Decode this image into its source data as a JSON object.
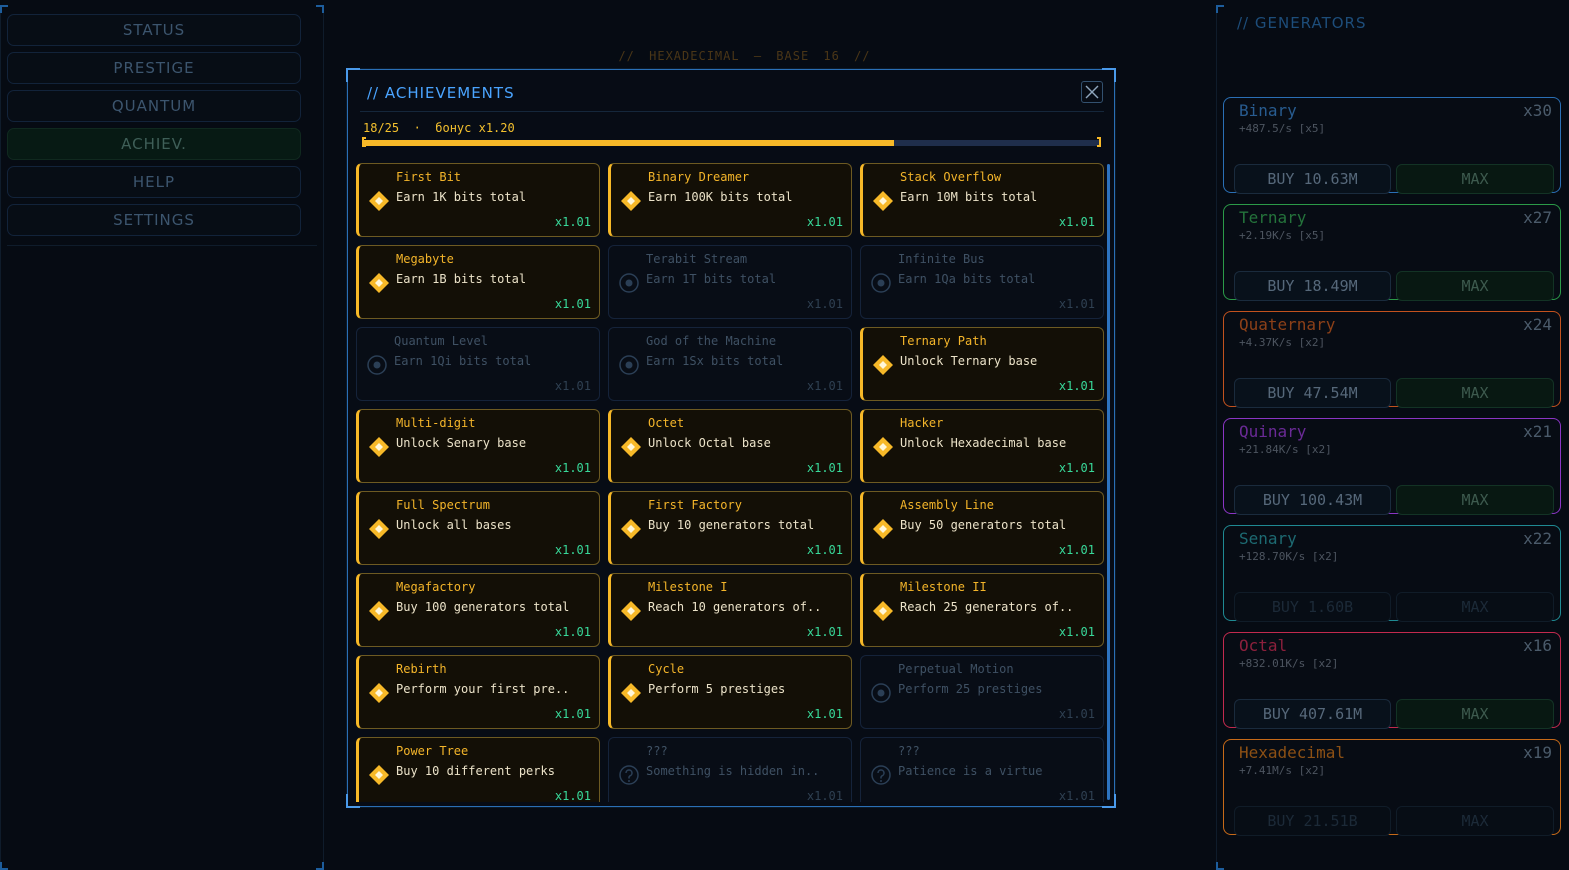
{
  "nav": {
    "items": [
      {
        "label": "STATUS"
      },
      {
        "label": "PRESTIGE"
      },
      {
        "label": "QUANTUM"
      },
      {
        "label": "ACHIEV."
      },
      {
        "label": "HELP"
      },
      {
        "label": "SETTINGS"
      }
    ],
    "active_index": 3
  },
  "base_title": "//  HEXADECIMAL  —  BASE 16  //",
  "generators": {
    "title": "// GENERATORS",
    "items": [
      {
        "name": "Binary",
        "count": "x30",
        "rate": "+487.5/s [x5]",
        "buy": "BUY 10.63M",
        "max": "MAX",
        "color": "#2a6fb5",
        "name_color": "#285c90",
        "affordable": true
      },
      {
        "name": "Ternary",
        "count": "x27",
        "rate": "+2.19K/s [x5]",
        "buy": "BUY 18.49M",
        "max": "MAX",
        "color": "#2b9a48",
        "name_color": "#24733b",
        "affordable": true
      },
      {
        "name": "Quaternary",
        "count": "x24",
        "rate": "+4.37K/s [x2]",
        "buy": "BUY 47.54M",
        "max": "MAX",
        "color": "#c2521e",
        "name_color": "#8c4018",
        "affordable": true
      },
      {
        "name": "Quinary",
        "count": "x21",
        "rate": "+21.84K/s [x2]",
        "buy": "BUY 100.43M",
        "max": "MAX",
        "color": "#8a35c4",
        "name_color": "#6a2a96",
        "affordable": true
      },
      {
        "name": "Senary",
        "count": "x22",
        "rate": "+128.70K/s [x2]",
        "buy": "BUY 1.60B",
        "max": "MAX",
        "color": "#1f8a93",
        "name_color": "#1d6a72",
        "affordable": false
      },
      {
        "name": "Octal",
        "count": "x16",
        "rate": "+832.01K/s [x2]",
        "buy": "BUY 407.61M",
        "max": "MAX",
        "color": "#c22a4e",
        "name_color": "#8c203c",
        "affordable": true
      },
      {
        "name": "Hexadecimal",
        "count": "x19",
        "rate": "+7.41M/s [x2]",
        "buy": "BUY 21.51B",
        "max": "MAX",
        "color": "#c76a18",
        "name_color": "#8c5014",
        "affordable": false
      }
    ]
  },
  "modal": {
    "title": "// ACHIEVEMENTS",
    "progress_text": "18/25  ·  бонус x1.20",
    "progress_fraction": 0.72,
    "cards": [
      {
        "name": "First Bit",
        "desc": "Earn 1K bits total",
        "mult": "x1.01",
        "unlocked": true
      },
      {
        "name": "Binary Dreamer",
        "desc": "Earn 100K bits total",
        "mult": "x1.01",
        "unlocked": true
      },
      {
        "name": "Stack Overflow",
        "desc": "Earn 10M bits total",
        "mult": "x1.01",
        "unlocked": true
      },
      {
        "name": "Megabyte",
        "desc": "Earn 1B bits total",
        "mult": "x1.01",
        "unlocked": true
      },
      {
        "name": "Terabit Stream",
        "desc": "Earn 1T bits total",
        "mult": "x1.01",
        "unlocked": false
      },
      {
        "name": "Infinite Bus",
        "desc": "Earn 1Qa bits total",
        "mult": "x1.01",
        "unlocked": false
      },
      {
        "name": "Quantum Level",
        "desc": "Earn 1Qi bits total",
        "mult": "x1.01",
        "unlocked": false
      },
      {
        "name": "God of the Machine",
        "desc": "Earn 1Sx bits total",
        "mult": "x1.01",
        "unlocked": false
      },
      {
        "name": "Ternary Path",
        "desc": "Unlock Ternary base",
        "mult": "x1.01",
        "unlocked": true
      },
      {
        "name": "Multi-digit",
        "desc": "Unlock Senary base",
        "mult": "x1.01",
        "unlocked": true
      },
      {
        "name": "Octet",
        "desc": "Unlock Octal base",
        "mult": "x1.01",
        "unlocked": true
      },
      {
        "name": "Hacker",
        "desc": "Unlock Hexadecimal base",
        "mult": "x1.01",
        "unlocked": true
      },
      {
        "name": "Full Spectrum",
        "desc": "Unlock all bases",
        "mult": "x1.01",
        "unlocked": true
      },
      {
        "name": "First Factory",
        "desc": "Buy 10 generators total",
        "mult": "x1.01",
        "unlocked": true
      },
      {
        "name": "Assembly Line",
        "desc": "Buy 50 generators total",
        "mult": "x1.01",
        "unlocked": true
      },
      {
        "name": "Megafactory",
        "desc": "Buy 100 generators total",
        "mult": "x1.01",
        "unlocked": true
      },
      {
        "name": "Milestone I",
        "desc": "Reach 10 generators of..",
        "mult": "x1.01",
        "unlocked": true
      },
      {
        "name": "Milestone II",
        "desc": "Reach 25 generators of..",
        "mult": "x1.01",
        "unlocked": true
      },
      {
        "name": "Rebirth",
        "desc": "Perform your first pre..",
        "mult": "x1.01",
        "unlocked": true
      },
      {
        "name": "Cycle",
        "desc": "Perform 5 prestiges",
        "mult": "x1.01",
        "unlocked": true
      },
      {
        "name": "Perpetual Motion",
        "desc": "Perform 25 prestiges",
        "mult": "x1.01",
        "unlocked": false
      },
      {
        "name": "Power Tree",
        "desc": "Buy 10 different perks",
        "mult": "x1.01",
        "unlocked": true
      },
      {
        "name": "???",
        "desc": "Something is hidden in..",
        "mult": "x1.01",
        "unlocked": false,
        "hidden": true
      },
      {
        "name": "???",
        "desc": "Patience is a virtue",
        "mult": "x1.01",
        "unlocked": false,
        "hidden": true
      }
    ]
  },
  "colors": {
    "accent_blue": "#4aa4ff",
    "gold": "#f7b928",
    "green": "#38d99a"
  }
}
